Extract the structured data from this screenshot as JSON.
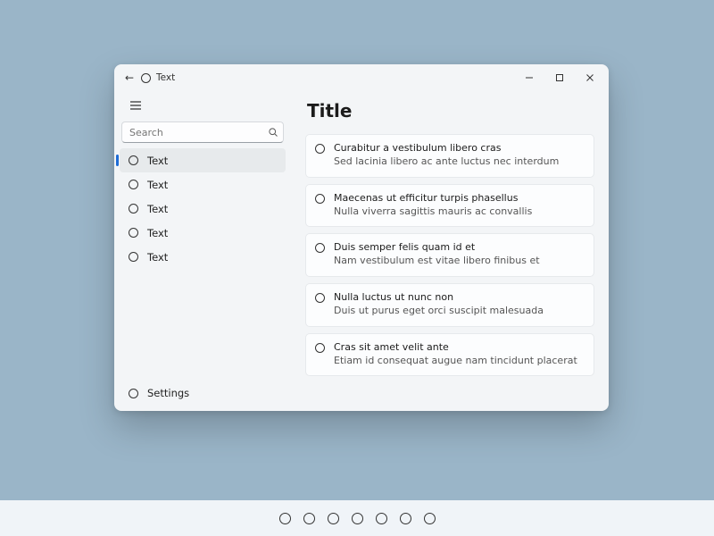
{
  "titlebar": {
    "back_glyph": "←",
    "title": "Text"
  },
  "sidebar": {
    "search_placeholder": "Search",
    "items": [
      {
        "label": "Text",
        "selected": true
      },
      {
        "label": "Text",
        "selected": false
      },
      {
        "label": "Text",
        "selected": false
      },
      {
        "label": "Text",
        "selected": false
      },
      {
        "label": "Text",
        "selected": false
      }
    ],
    "settings_label": "Settings"
  },
  "main": {
    "title": "Title",
    "cards": [
      {
        "line1": "Curabitur a vestibulum libero cras",
        "line2": "Sed lacinia libero ac ante luctus nec interdum"
      },
      {
        "line1": "Maecenas ut efficitur turpis phasellus",
        "line2": "Nulla viverra sagittis mauris ac convallis"
      },
      {
        "line1": "Duis semper felis quam id et",
        "line2": "Nam vestibulum est vitae libero finibus et"
      },
      {
        "line1": "Nulla luctus ut nunc non",
        "line2": "Duis ut purus eget orci suscipit malesuada"
      },
      {
        "line1": "Cras sit amet velit ante",
        "line2": "Etiam id consequat augue nam tincidunt placerat"
      }
    ]
  },
  "dock": {
    "count": 7
  }
}
